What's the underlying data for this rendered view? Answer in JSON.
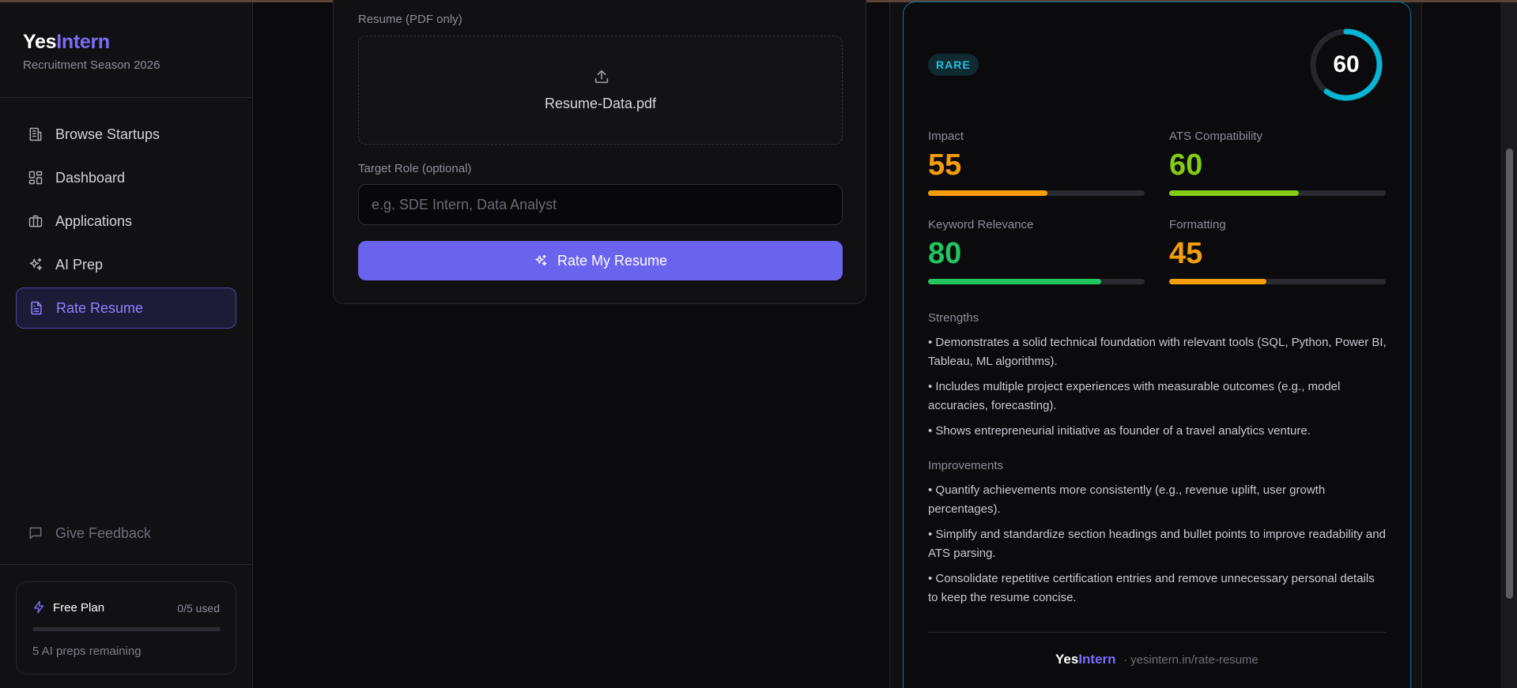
{
  "brand": {
    "part1": "Yes",
    "part2": "Intern",
    "subtitle": "Recruitment Season 2026"
  },
  "nav": {
    "items": [
      {
        "label": "Browse Startups",
        "icon": "building-icon"
      },
      {
        "label": "Dashboard",
        "icon": "grid-icon"
      },
      {
        "label": "Applications",
        "icon": "briefcase-icon"
      },
      {
        "label": "AI Prep",
        "icon": "sparkles-icon"
      },
      {
        "label": "Rate Resume",
        "icon": "file-text-icon",
        "active": true
      }
    ],
    "feedback": "Give Feedback"
  },
  "plan": {
    "title": "Free Plan",
    "used": "0/5 used",
    "remaining": "5 AI preps remaining",
    "usage_fraction": 0
  },
  "form": {
    "resume_label": "Resume (PDF only)",
    "file_name": "Resume-Data.pdf",
    "role_label": "Target Role (optional)",
    "role_placeholder": "e.g. SDE Intern, Data Analyst",
    "role_value": "",
    "submit_label": "Rate My Resume"
  },
  "result": {
    "badge": "RARE",
    "overall_score": "60",
    "overall_fraction": 0.6,
    "metrics": [
      {
        "label": "Impact",
        "value": "55",
        "fraction": 0.55,
        "color": "#f59e0b"
      },
      {
        "label": "ATS Compatibility",
        "value": "60",
        "fraction": 0.6,
        "color": "#84cc16"
      },
      {
        "label": "Keyword Relevance",
        "value": "80",
        "fraction": 0.8,
        "color": "#22c55e"
      },
      {
        "label": "Formatting",
        "value": "45",
        "fraction": 0.45,
        "color": "#f59e0b"
      }
    ],
    "strengths_title": "Strengths",
    "strengths": [
      "• Demonstrates a solid technical foundation with relevant tools (SQL, Python, Power BI, Tableau, ML algorithms).",
      "• Includes multiple project experiences with measurable outcomes (e.g., model accuracies, forecasting).",
      "• Shows entrepreneurial initiative as founder of a travel analytics venture."
    ],
    "improvements_title": "Improvements",
    "improvements": [
      "• Quantify achievements more consistently (e.g., revenue uplift, user growth percentages).",
      "• Simplify and standardize section headings and bullet points to improve readability and ATS parsing.",
      "• Consolidate repetitive certification entries and remove unnecessary personal details to keep the resume concise."
    ],
    "footer_brand_1": "Yes",
    "footer_brand_2": "Intern",
    "footer_url": "· yesintern.in/rate-resume"
  },
  "colors": {
    "accent": "#6a63ee",
    "ring": "#06b6d4",
    "badge": "#22c1e0"
  }
}
